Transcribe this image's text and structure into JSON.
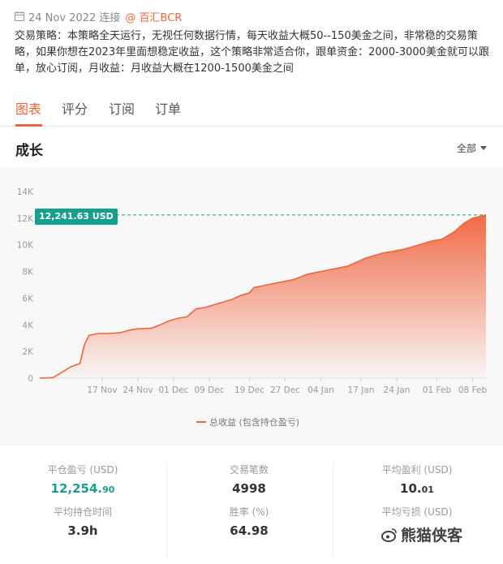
{
  "meta": {
    "date": "24 Nov 2022 连接",
    "provider": "@ 百汇BCR"
  },
  "description": "交易策略：本策略全天运行，无视任何数据行情，每天收益大概50--150美金之间，非常稳的交易策略，如果你想在2023年里面想稳定收益，这个策略非常适合你，跟单资金：2000-3000美金就可以跟单，放心订阅，月收益：月收益大概在1200-1500美金之间",
  "tabs": [
    "图表",
    "评分",
    "订阅",
    "订单"
  ],
  "section": {
    "title": "成长",
    "filter": "全部"
  },
  "colors": {
    "accent": "#f0643c",
    "positive": "#14a08a"
  },
  "chart_data": {
    "type": "area",
    "title": "成长",
    "legend": "总收益 (包含持仓盈亏)",
    "last_value_label": "12,241.63 USD",
    "last_value": 12241.63,
    "ylim": [
      0,
      14000
    ],
    "yticks": [
      "0",
      "2K",
      "4K",
      "6K",
      "8K",
      "10K",
      "12K",
      "14K"
    ],
    "xticks": [
      "17 Nov",
      "24 Nov",
      "01 Dec",
      "09 Dec",
      "19 Dec",
      "27 Dec",
      "04 Jan",
      "17 Jan",
      "24 Jan",
      "01 Feb",
      "08 Feb"
    ],
    "x_index_range": [
      0,
      100
    ],
    "xtick_index": [
      14,
      22,
      30,
      38,
      47,
      55,
      63,
      72,
      80,
      89,
      97
    ],
    "points": [
      [
        0,
        0
      ],
      [
        3,
        40
      ],
      [
        5,
        450
      ],
      [
        7,
        850
      ],
      [
        9,
        1100
      ],
      [
        10,
        2500
      ],
      [
        11,
        3200
      ],
      [
        13,
        3350
      ],
      [
        15,
        3350
      ],
      [
        18,
        3400
      ],
      [
        20,
        3600
      ],
      [
        22,
        3700
      ],
      [
        25,
        3750
      ],
      [
        27,
        4000
      ],
      [
        29,
        4300
      ],
      [
        31,
        4500
      ],
      [
        33,
        4600
      ],
      [
        35,
        5200
      ],
      [
        37,
        5300
      ],
      [
        39,
        5500
      ],
      [
        41,
        5700
      ],
      [
        43,
        5900
      ],
      [
        45,
        6200
      ],
      [
        47,
        6400
      ],
      [
        48,
        6800
      ],
      [
        51,
        7000
      ],
      [
        54,
        7200
      ],
      [
        57,
        7400
      ],
      [
        60,
        7800
      ],
      [
        63,
        8000
      ],
      [
        66,
        8200
      ],
      [
        69,
        8400
      ],
      [
        71,
        8700
      ],
      [
        73,
        9000
      ],
      [
        75,
        9200
      ],
      [
        77,
        9400
      ],
      [
        79,
        9500
      ],
      [
        82,
        9700
      ],
      [
        84,
        9900
      ],
      [
        86,
        10100
      ],
      [
        88,
        10300
      ],
      [
        90,
        10400
      ],
      [
        91,
        10600
      ],
      [
        93,
        11000
      ],
      [
        95,
        11600
      ],
      [
        97,
        12000
      ],
      [
        100,
        12241.63
      ]
    ]
  },
  "stats": {
    "closed_pl_label": "平仓盈亏 (USD)",
    "closed_pl_int": "12,254.",
    "closed_pl_dec": "90",
    "trades_label": "交易笔数",
    "trades_value": "4998",
    "avg_profit_label": "平均盈利 (USD)",
    "avg_profit_int": "10.",
    "avg_profit_dec": "01",
    "avg_hold_label": "平均持仓时间",
    "avg_hold_value": "3.9h",
    "winrate_label": "胜率 (%)",
    "winrate_value": "64.98",
    "avg_loss_label": "平均亏损 (USD)"
  },
  "watermark": "熊猫侠客"
}
